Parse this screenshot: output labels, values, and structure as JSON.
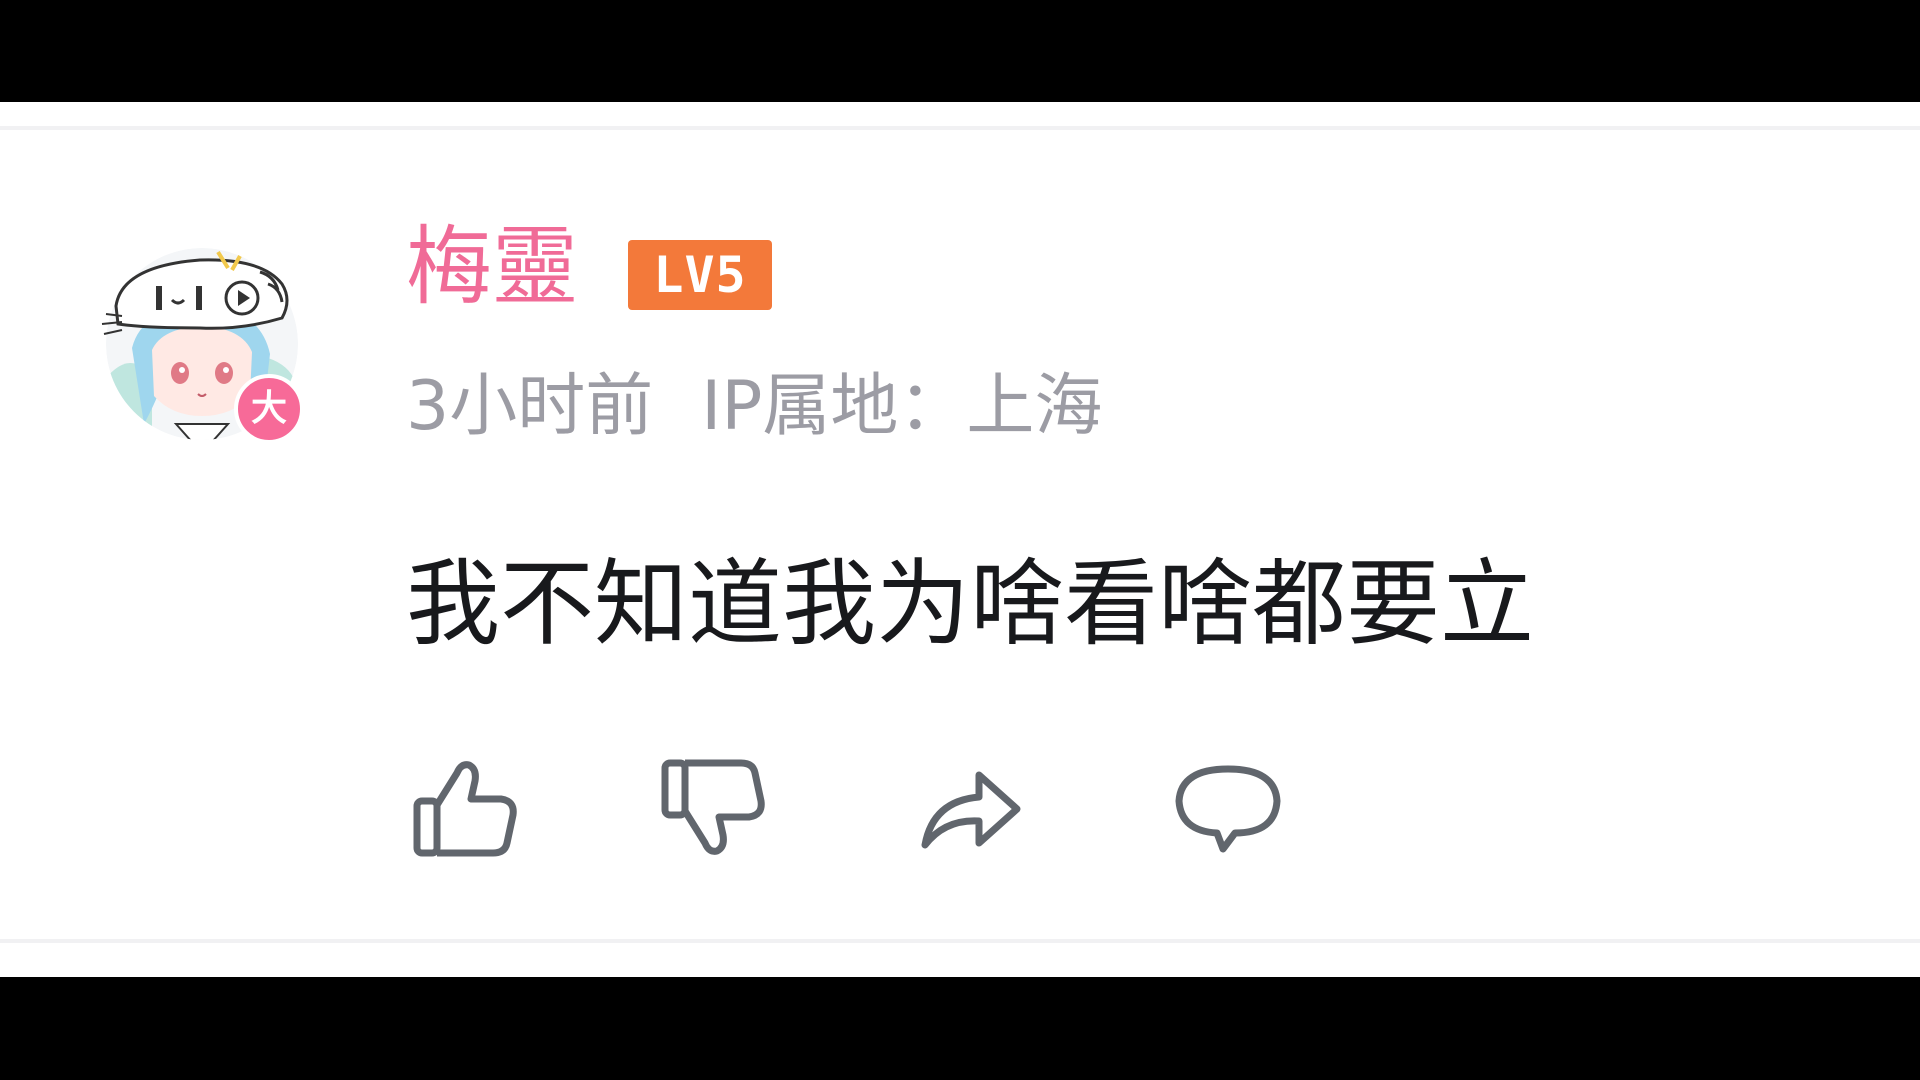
{
  "comment": {
    "username": "梅靈",
    "level_badge": "LV5",
    "avatar_badge": "大",
    "time": "3小时前",
    "ip_location": "IP属地：上海",
    "text": "我不知道我为啥看啥都要立"
  },
  "actions": [
    {
      "icon": "thumbs-up-icon"
    },
    {
      "icon": "thumbs-down-icon"
    },
    {
      "icon": "share-icon"
    },
    {
      "icon": "comment-icon"
    }
  ],
  "colors": {
    "username": "#f06b97",
    "level_badge": "#f3793a",
    "avatar_badge": "#f76a98",
    "meta_text": "#9c9ca4",
    "body_text": "#18191c",
    "icon_stroke": "#61666d"
  }
}
